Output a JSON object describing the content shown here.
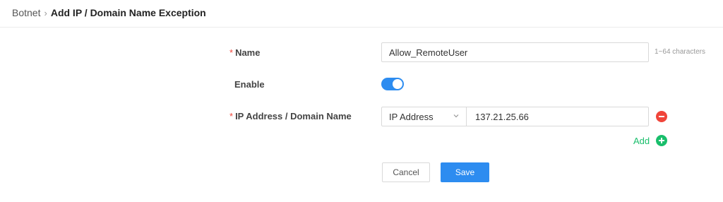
{
  "breadcrumb": {
    "parent": "Botnet",
    "separator": "›",
    "current": "Add IP / Domain Name Exception"
  },
  "form": {
    "required_marker": "*",
    "name": {
      "label": "Name",
      "value": "Allow_RemoteUser",
      "hint": "1~64 characters"
    },
    "enable": {
      "label": "Enable",
      "checked": true
    },
    "address": {
      "label": "IP Address / Domain Name",
      "type_selected": "IP Address",
      "value": "137.21.25.66"
    },
    "add_label": "Add"
  },
  "actions": {
    "cancel_label": "Cancel",
    "save_label": "Save"
  },
  "colors": {
    "primary": "#2d8cf0",
    "success": "#19be6b",
    "danger": "#f0453a"
  },
  "icons": {
    "breadcrumb_separator": "chevron-right-icon",
    "select_arrow": "chevron-down-icon",
    "remove": "minus-circle-icon",
    "add": "plus-circle-icon"
  }
}
